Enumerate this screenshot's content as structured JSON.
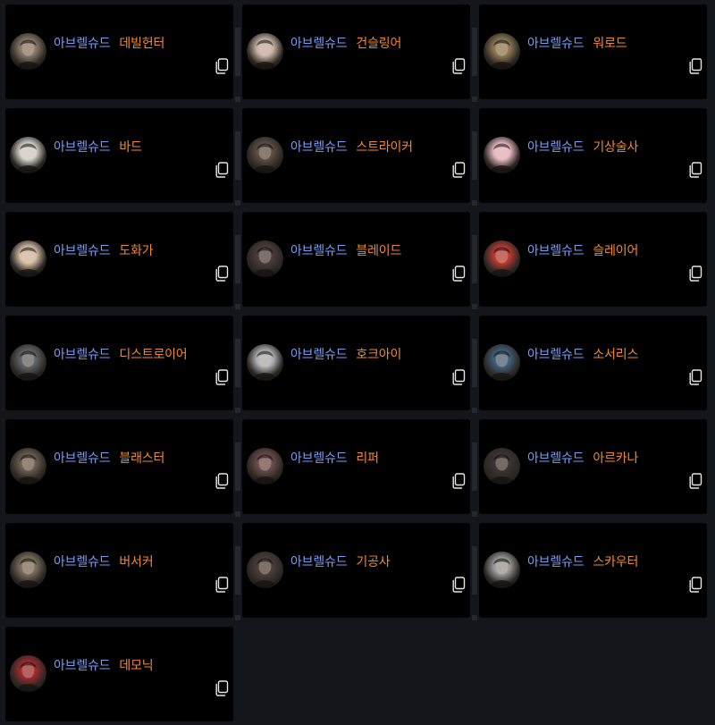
{
  "server_name": "아브렐슈드",
  "characters": [
    {
      "class": "데빌헌터",
      "portrait_icon": "devil-hunter-portrait-icon",
      "tone": "#8a7a6a"
    },
    {
      "class": "건슬링어",
      "portrait_icon": "gunslinger-portrait-icon",
      "tone": "#c9b6a9"
    },
    {
      "class": "워로드",
      "portrait_icon": "warlord-portrait-icon",
      "tone": "#8e7a55"
    },
    {
      "class": "바드",
      "portrait_icon": "bard-portrait-icon",
      "tone": "#d8d4d0"
    },
    {
      "class": "스트라이커",
      "portrait_icon": "striker-portrait-icon",
      "tone": "#5b4e46"
    },
    {
      "class": "기상술사",
      "portrait_icon": "aeromancer-portrait-icon",
      "tone": "#e8b9c4"
    },
    {
      "class": "도화가",
      "portrait_icon": "artist-portrait-icon",
      "tone": "#d9c0a8"
    },
    {
      "class": "블레이드",
      "portrait_icon": "blade-portrait-icon",
      "tone": "#4a3c3c"
    },
    {
      "class": "슬레이어",
      "portrait_icon": "slayer-portrait-icon",
      "tone": "#b83a32"
    },
    {
      "class": "디스트로이어",
      "portrait_icon": "destroyer-portrait-icon",
      "tone": "#5f6468"
    },
    {
      "class": "호크아이",
      "portrait_icon": "hawkeye-portrait-icon",
      "tone": "#b0b4b8"
    },
    {
      "class": "소서리스",
      "portrait_icon": "sorceress-portrait-icon",
      "tone": "#3f5f7a"
    },
    {
      "class": "블래스터",
      "portrait_icon": "blaster-portrait-icon",
      "tone": "#6b5e52"
    },
    {
      "class": "리퍼",
      "portrait_icon": "reaper-portrait-icon",
      "tone": "#6a4b4b"
    },
    {
      "class": "아르카나",
      "portrait_icon": "arcana-portrait-icon",
      "tone": "#3a3434"
    },
    {
      "class": "버서커",
      "portrait_icon": "berserker-portrait-icon",
      "tone": "#7a6e5e"
    },
    {
      "class": "기공사",
      "portrait_icon": "soulfist-portrait-icon",
      "tone": "#4a3e3a"
    },
    {
      "class": "스카우터",
      "portrait_icon": "scouter-portrait-icon",
      "tone": "#9a9a9a"
    },
    {
      "class": "데모닉",
      "portrait_icon": "demonic-portrait-icon",
      "tone": "#9a2c2c"
    }
  ],
  "colors": {
    "server_text": "#7a9df5",
    "class_text": "#f08a2e",
    "card_bg": "#000000",
    "page_bg": "#14161b"
  },
  "copy_icon": "copy-icon"
}
